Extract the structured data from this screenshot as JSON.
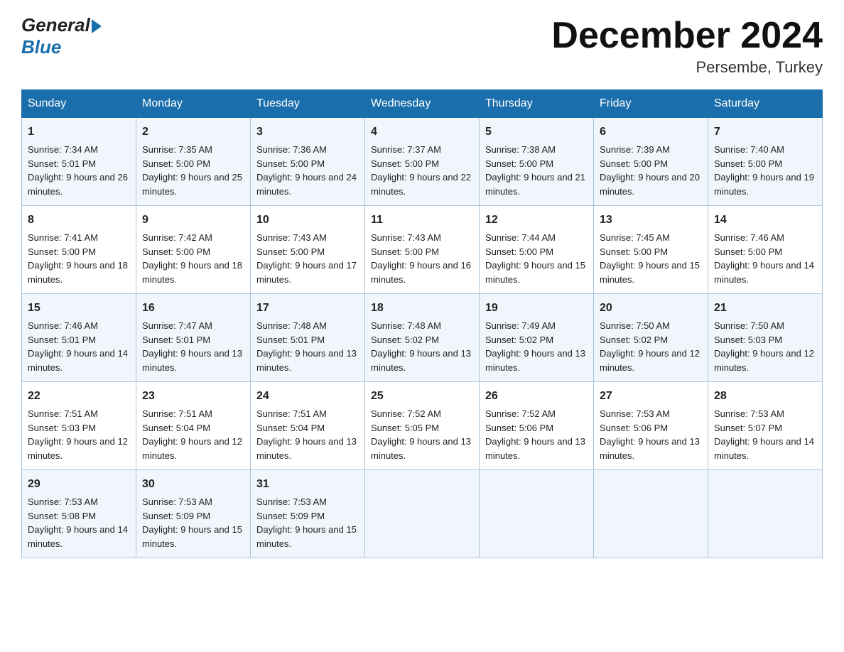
{
  "header": {
    "logo_general": "General",
    "logo_blue": "Blue",
    "month_title": "December 2024",
    "location": "Persembe, Turkey"
  },
  "days_of_week": [
    "Sunday",
    "Monday",
    "Tuesday",
    "Wednesday",
    "Thursday",
    "Friday",
    "Saturday"
  ],
  "weeks": [
    [
      {
        "day": "1",
        "sunrise": "7:34 AM",
        "sunset": "5:01 PM",
        "daylight": "9 hours and 26 minutes."
      },
      {
        "day": "2",
        "sunrise": "7:35 AM",
        "sunset": "5:00 PM",
        "daylight": "9 hours and 25 minutes."
      },
      {
        "day": "3",
        "sunrise": "7:36 AM",
        "sunset": "5:00 PM",
        "daylight": "9 hours and 24 minutes."
      },
      {
        "day": "4",
        "sunrise": "7:37 AM",
        "sunset": "5:00 PM",
        "daylight": "9 hours and 22 minutes."
      },
      {
        "day": "5",
        "sunrise": "7:38 AM",
        "sunset": "5:00 PM",
        "daylight": "9 hours and 21 minutes."
      },
      {
        "day": "6",
        "sunrise": "7:39 AM",
        "sunset": "5:00 PM",
        "daylight": "9 hours and 20 minutes."
      },
      {
        "day": "7",
        "sunrise": "7:40 AM",
        "sunset": "5:00 PM",
        "daylight": "9 hours and 19 minutes."
      }
    ],
    [
      {
        "day": "8",
        "sunrise": "7:41 AM",
        "sunset": "5:00 PM",
        "daylight": "9 hours and 18 minutes."
      },
      {
        "day": "9",
        "sunrise": "7:42 AM",
        "sunset": "5:00 PM",
        "daylight": "9 hours and 18 minutes."
      },
      {
        "day": "10",
        "sunrise": "7:43 AM",
        "sunset": "5:00 PM",
        "daylight": "9 hours and 17 minutes."
      },
      {
        "day": "11",
        "sunrise": "7:43 AM",
        "sunset": "5:00 PM",
        "daylight": "9 hours and 16 minutes."
      },
      {
        "day": "12",
        "sunrise": "7:44 AM",
        "sunset": "5:00 PM",
        "daylight": "9 hours and 15 minutes."
      },
      {
        "day": "13",
        "sunrise": "7:45 AM",
        "sunset": "5:00 PM",
        "daylight": "9 hours and 15 minutes."
      },
      {
        "day": "14",
        "sunrise": "7:46 AM",
        "sunset": "5:00 PM",
        "daylight": "9 hours and 14 minutes."
      }
    ],
    [
      {
        "day": "15",
        "sunrise": "7:46 AM",
        "sunset": "5:01 PM",
        "daylight": "9 hours and 14 minutes."
      },
      {
        "day": "16",
        "sunrise": "7:47 AM",
        "sunset": "5:01 PM",
        "daylight": "9 hours and 13 minutes."
      },
      {
        "day": "17",
        "sunrise": "7:48 AM",
        "sunset": "5:01 PM",
        "daylight": "9 hours and 13 minutes."
      },
      {
        "day": "18",
        "sunrise": "7:48 AM",
        "sunset": "5:02 PM",
        "daylight": "9 hours and 13 minutes."
      },
      {
        "day": "19",
        "sunrise": "7:49 AM",
        "sunset": "5:02 PM",
        "daylight": "9 hours and 13 minutes."
      },
      {
        "day": "20",
        "sunrise": "7:50 AM",
        "sunset": "5:02 PM",
        "daylight": "9 hours and 12 minutes."
      },
      {
        "day": "21",
        "sunrise": "7:50 AM",
        "sunset": "5:03 PM",
        "daylight": "9 hours and 12 minutes."
      }
    ],
    [
      {
        "day": "22",
        "sunrise": "7:51 AM",
        "sunset": "5:03 PM",
        "daylight": "9 hours and 12 minutes."
      },
      {
        "day": "23",
        "sunrise": "7:51 AM",
        "sunset": "5:04 PM",
        "daylight": "9 hours and 12 minutes."
      },
      {
        "day": "24",
        "sunrise": "7:51 AM",
        "sunset": "5:04 PM",
        "daylight": "9 hours and 13 minutes."
      },
      {
        "day": "25",
        "sunrise": "7:52 AM",
        "sunset": "5:05 PM",
        "daylight": "9 hours and 13 minutes."
      },
      {
        "day": "26",
        "sunrise": "7:52 AM",
        "sunset": "5:06 PM",
        "daylight": "9 hours and 13 minutes."
      },
      {
        "day": "27",
        "sunrise": "7:53 AM",
        "sunset": "5:06 PM",
        "daylight": "9 hours and 13 minutes."
      },
      {
        "day": "28",
        "sunrise": "7:53 AM",
        "sunset": "5:07 PM",
        "daylight": "9 hours and 14 minutes."
      }
    ],
    [
      {
        "day": "29",
        "sunrise": "7:53 AM",
        "sunset": "5:08 PM",
        "daylight": "9 hours and 14 minutes."
      },
      {
        "day": "30",
        "sunrise": "7:53 AM",
        "sunset": "5:09 PM",
        "daylight": "9 hours and 15 minutes."
      },
      {
        "day": "31",
        "sunrise": "7:53 AM",
        "sunset": "5:09 PM",
        "daylight": "9 hours and 15 minutes."
      },
      null,
      null,
      null,
      null
    ]
  ]
}
